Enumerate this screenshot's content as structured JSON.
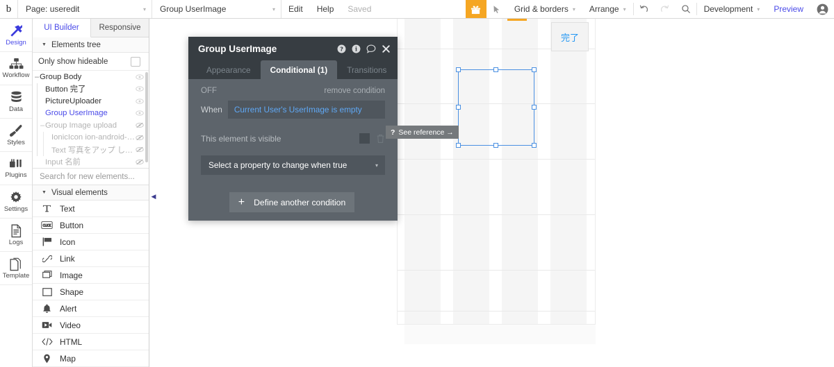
{
  "topbar": {
    "logo": "b",
    "page_select": {
      "label": "Page: useredit",
      "caret": "▾"
    },
    "element_select": {
      "label": "Group UserImage",
      "caret": "▾"
    },
    "edit": "Edit",
    "help": "Help",
    "saved": "Saved",
    "gift_icon": "gift-icon",
    "cursor_icon": "cursor-arrow-icon",
    "grid_borders": {
      "label": "Grid & borders",
      "caret": "▾"
    },
    "arrange": {
      "label": "Arrange",
      "caret": "▾"
    },
    "undo_icon": "undo-icon",
    "redo_icon": "redo-icon",
    "search_icon": "search-icon",
    "version": {
      "label": "Development",
      "caret": "▾"
    },
    "preview": "Preview",
    "avatar_icon": "user-avatar-icon",
    "accent_orange": "#f5a623",
    "accent_blue": "#4a4ae8"
  },
  "rail": {
    "items": [
      {
        "label": "Design",
        "icon": "design-tools-icon",
        "active": true
      },
      {
        "label": "Workflow",
        "icon": "workflow-tree-icon",
        "active": false
      },
      {
        "label": "Data",
        "icon": "database-icon",
        "active": false
      },
      {
        "label": "Styles",
        "icon": "paintbrush-icon",
        "active": false
      },
      {
        "label": "Plugins",
        "icon": "plugins-icon",
        "active": false
      },
      {
        "label": "Settings",
        "icon": "gear-icon",
        "active": false
      },
      {
        "label": "Logs",
        "icon": "document-lines-icon",
        "active": false
      },
      {
        "label": "Template",
        "icon": "template-pages-icon",
        "active": false
      }
    ]
  },
  "panel": {
    "tabs": [
      {
        "label": "UI Builder",
        "active": true
      },
      {
        "label": "Responsive",
        "active": false
      }
    ],
    "elements_tree_header": "Elements tree",
    "only_show_hideable": "Only show hideable",
    "only_show_hideable_checked": false,
    "tree": [
      {
        "label": "Group Body",
        "depth": 0,
        "dash": "–",
        "selected": false,
        "dim": false,
        "eye": "eye-icon"
      },
      {
        "label": "Button 完了",
        "depth": 1,
        "dash": "",
        "selected": false,
        "dim": false,
        "eye": "eye-icon"
      },
      {
        "label": "PictureUploader",
        "depth": 1,
        "dash": "",
        "selected": false,
        "dim": false,
        "eye": "eye-icon"
      },
      {
        "label": "Group UserImage",
        "depth": 1,
        "dash": "",
        "selected": true,
        "dim": false,
        "eye": "eye-icon"
      },
      {
        "label": "Group Image upload",
        "depth": 1,
        "dash": "–",
        "selected": false,
        "dim": true,
        "eye": "eye-slash-icon"
      },
      {
        "label": "IonicIcon ion-android-c...",
        "depth": 2,
        "dash": "",
        "selected": false,
        "dim": true,
        "eye": "eye-slash-icon"
      },
      {
        "label": "Text 写真をアップ して...",
        "depth": 2,
        "dash": "",
        "selected": false,
        "dim": true,
        "eye": "eye-slash-icon"
      },
      {
        "label": "Input 名前",
        "depth": 1,
        "dash": "",
        "selected": false,
        "dim": true,
        "eye": "eye-slash-icon"
      }
    ],
    "search_placeholder": "Search for new elements...",
    "visual_elements_header": "Visual elements",
    "visual_elements": [
      {
        "label": "Text",
        "icon": "text-serif-T-icon"
      },
      {
        "label": "Button",
        "icon": "button-click-icon"
      },
      {
        "label": "Icon",
        "icon": "flag-icon"
      },
      {
        "label": "Link",
        "icon": "chain-link-icon"
      },
      {
        "label": "Image",
        "icon": "image-icon"
      },
      {
        "label": "Shape",
        "icon": "rectangle-shape-icon"
      },
      {
        "label": "Alert",
        "icon": "bell-icon"
      },
      {
        "label": "Video",
        "icon": "video-camera-icon"
      },
      {
        "label": "HTML",
        "icon": "code-brackets-icon"
      },
      {
        "label": "Map",
        "icon": "map-pin-icon"
      }
    ],
    "collapse_icon": "collapse-left-icon"
  },
  "canvas": {
    "done_button": "完了",
    "done_button_color": "#2196f3",
    "selection_color": "#4a90e2",
    "selection_handles": 8,
    "grid_marker_color": "#f5a623"
  },
  "dialog": {
    "title": "Group UserImage",
    "title_icons": [
      {
        "name": "help-circle-icon",
        "glyph": "?"
      },
      {
        "name": "info-circle-icon",
        "glyph": "i"
      },
      {
        "name": "comment-bubble-icon",
        "glyph": ""
      },
      {
        "name": "close-icon",
        "glyph": "✕"
      }
    ],
    "tabs": [
      {
        "label": "Appearance",
        "active": false
      },
      {
        "label": "Conditional (1)",
        "active": true
      },
      {
        "label": "Transitions",
        "active": false
      }
    ],
    "condition_state": "OFF",
    "remove_condition": "remove condition",
    "when_label": "When",
    "when_expression": "Current User's UserImage is empty",
    "visible_label": "This element is visible",
    "visible_checked": false,
    "trash_icon": "trash-icon",
    "property_select": "Select a property to change when true",
    "property_caret": "▾",
    "define_another": "Define another condition",
    "plus_icon": "+"
  },
  "tooltip": {
    "icon_glyph": "?",
    "text": "See reference →"
  }
}
